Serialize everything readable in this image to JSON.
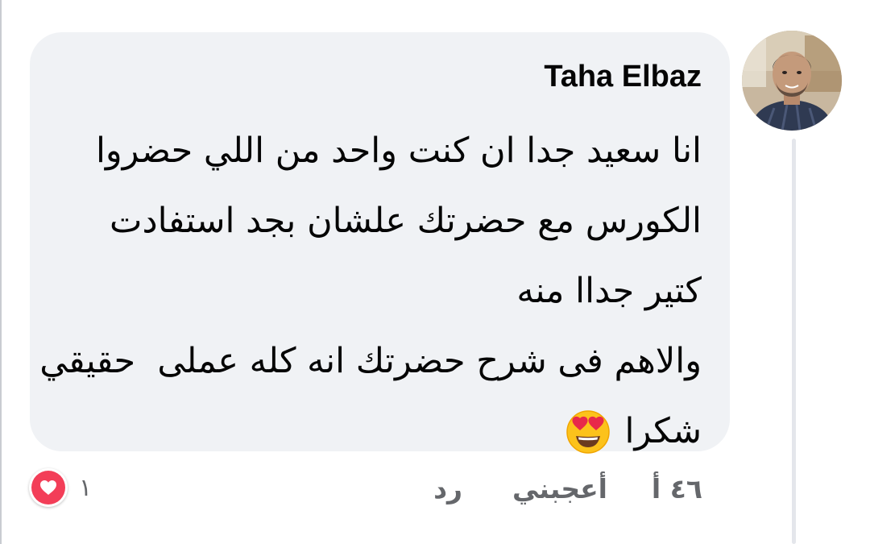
{
  "comment": {
    "author": "Taha Elbaz",
    "lines": [
      "انا سعيد جدا ان كنت واحد من اللي حضروا",
      "الكورس مع حضرتك علشان بجد استفادت",
      "كتير جداا منه",
      "والاهم فى شرح حضرتك انه كله عملى  حقيقي",
      "شكرا"
    ],
    "emoji": "heart-eyes-emoji"
  },
  "actions": {
    "time": "٤٦ أ",
    "like_label": "أعجبني",
    "reply_label": "رد"
  },
  "reactions": {
    "icon": "heart-icon",
    "count": "١",
    "color": "#f33e58"
  },
  "colors": {
    "bubble": "#f0f2f5",
    "text": "#050505",
    "secondary_text": "#65676b"
  }
}
